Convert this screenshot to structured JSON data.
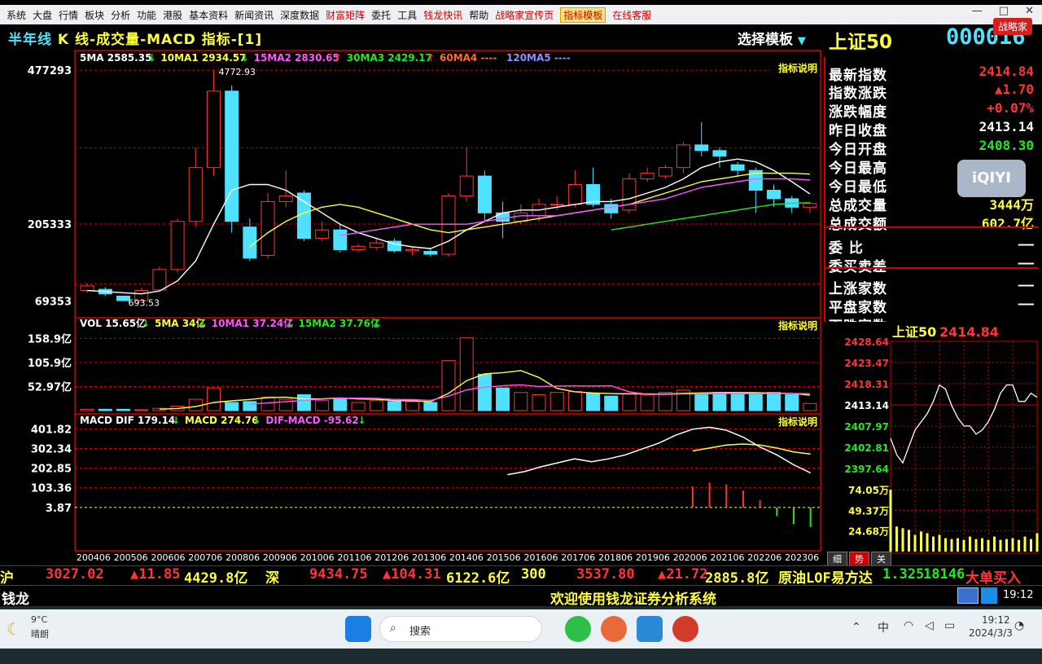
{
  "menu": [
    "系统",
    "大盘",
    "行情",
    "板块",
    "分析",
    "功能",
    "港股",
    "基本资料",
    "新闻资讯",
    "深度数据",
    "财富矩阵",
    "委托",
    "工具",
    "钱龙快讯",
    "帮助",
    "战略家宣传页",
    "指标模板",
    "在线客服"
  ],
  "menu_red": [
    false,
    false,
    false,
    false,
    false,
    false,
    false,
    false,
    false,
    false,
    true,
    false,
    false,
    true,
    false,
    true,
    true,
    true
  ],
  "title": {
    "period": "半年线",
    "chart_title": "K 线-成交量-MACD 指标-[1]",
    "choose_template": "选择模板",
    "name": "上证50",
    "code": "000016",
    "brand": "战略家"
  },
  "kline": {
    "legend": [
      {
        "text": "5MA 2585.35",
        "color": "#ffffff",
        "arrow": "↓",
        "arrow_color": "#22e722"
      },
      {
        "text": "10MA1 2934.57",
        "color": "#ffff3a",
        "arrow": "↓",
        "arrow_color": "#22e722"
      },
      {
        "text": "15MA2 2830.65",
        "color": "#ff55ff",
        "arrow": "↑",
        "arrow_color": "#ff3434"
      },
      {
        "text": "30MA3 2429.17",
        "color": "#22e722",
        "arrow": "↑",
        "arrow_color": "#ff3434"
      },
      {
        "text": "60MA4 ----",
        "color": "#ff6b2b",
        "arrow": "",
        "arrow_color": ""
      },
      {
        "text": "120MA5 ----",
        "color": "#8f8fff",
        "arrow": "",
        "arrow_color": ""
      }
    ],
    "y_labels": [
      "477293",
      "205333",
      "69353"
    ],
    "high_label": "4772.93",
    "low_label": "693.53",
    "indicator_note": "指标说明",
    "candles": [
      {
        "o": 880,
        "c": 960,
        "h": 1010,
        "l": 840
      },
      {
        "o": 900,
        "c": 820,
        "h": 940,
        "l": 780
      },
      {
        "o": 780,
        "c": 700,
        "h": 790,
        "l": 690
      },
      {
        "o": 700,
        "c": 880,
        "h": 930,
        "l": 690
      },
      {
        "o": 890,
        "c": 1250,
        "h": 1300,
        "l": 870
      },
      {
        "o": 1250,
        "c": 2100,
        "h": 2150,
        "l": 1200
      },
      {
        "o": 2100,
        "c": 3050,
        "h": 3400,
        "l": 2000
      },
      {
        "o": 3050,
        "c": 4400,
        "h": 4772,
        "l": 2900
      },
      {
        "o": 4400,
        "c": 2100,
        "h": 4500,
        "l": 1900
      },
      {
        "o": 2000,
        "c": 1450,
        "h": 2150,
        "l": 1400
      },
      {
        "o": 1500,
        "c": 2450,
        "h": 2600,
        "l": 1450
      },
      {
        "o": 2450,
        "c": 2550,
        "h": 3000,
        "l": 2350
      },
      {
        "o": 2600,
        "c": 1800,
        "h": 2650,
        "l": 1750
      },
      {
        "o": 1800,
        "c": 1950,
        "h": 2100,
        "l": 1750
      },
      {
        "o": 1950,
        "c": 1600,
        "h": 2050,
        "l": 1550
      },
      {
        "o": 1600,
        "c": 1660,
        "h": 1700,
        "l": 1550
      },
      {
        "o": 1640,
        "c": 1720,
        "h": 1800,
        "l": 1600
      },
      {
        "o": 1750,
        "c": 1580,
        "h": 1800,
        "l": 1550
      },
      {
        "o": 1580,
        "c": 1600,
        "h": 1650,
        "l": 1500
      },
      {
        "o": 1570,
        "c": 1520,
        "h": 1620,
        "l": 1480
      },
      {
        "o": 1520,
        "c": 2550,
        "h": 2600,
        "l": 1480
      },
      {
        "o": 2550,
        "c": 2900,
        "h": 3400,
        "l": 2450
      },
      {
        "o": 2900,
        "c": 2250,
        "h": 3000,
        "l": 2100
      },
      {
        "o": 2250,
        "c": 2100,
        "h": 2450,
        "l": 1800
      },
      {
        "o": 2100,
        "c": 2250,
        "h": 2400,
        "l": 2050
      },
      {
        "o": 2200,
        "c": 2400,
        "h": 2500,
        "l": 2100
      },
      {
        "o": 2400,
        "c": 2400,
        "h": 2550,
        "l": 2300
      },
      {
        "o": 2400,
        "c": 2750,
        "h": 3000,
        "l": 2350
      },
      {
        "o": 2750,
        "c": 2400,
        "h": 3050,
        "l": 2350
      },
      {
        "o": 2400,
        "c": 2250,
        "h": 2500,
        "l": 2150
      },
      {
        "o": 2300,
        "c": 2850,
        "h": 2950,
        "l": 2250
      },
      {
        "o": 2850,
        "c": 2950,
        "h": 3050,
        "l": 2800
      },
      {
        "o": 2900,
        "c": 3050,
        "h": 3100,
        "l": 2850
      },
      {
        "o": 3050,
        "c": 3450,
        "h": 3500,
        "l": 2950
      },
      {
        "o": 3450,
        "c": 3350,
        "h": 3850,
        "l": 3250
      },
      {
        "o": 3350,
        "c": 3250,
        "h": 3400,
        "l": 3050
      },
      {
        "o": 3100,
        "c": 3000,
        "h": 3150,
        "l": 2900
      },
      {
        "o": 3000,
        "c": 2650,
        "h": 3050,
        "l": 2250
      },
      {
        "o": 2650,
        "c": 2500,
        "h": 2750,
        "l": 2350
      },
      {
        "o": 2500,
        "c": 2350,
        "h": 2550,
        "l": 2250
      },
      {
        "o": 2350,
        "c": 2415,
        "h": 2450,
        "l": 2250
      }
    ],
    "ma5": [
      880,
      860,
      840,
      820,
      870,
      1050,
      1400,
      2050,
      2650,
      2750,
      2750,
      2650,
      2450,
      2250,
      2050,
      1900,
      1800,
      1700,
      1650,
      1620,
      1750,
      1950,
      2100,
      2250,
      2300,
      2300,
      2350,
      2400,
      2450,
      2450,
      2500,
      2600,
      2700,
      2850,
      3050,
      3150,
      3200,
      3150,
      3000,
      2800,
      2585
    ],
    "ma10": [
      null,
      null,
      null,
      null,
      null,
      null,
      null,
      null,
      null,
      1650,
      1900,
      2100,
      2250,
      2350,
      2400,
      2350,
      2250,
      2150,
      2050,
      1950,
      1900,
      1950,
      2000,
      2050,
      2100,
      2150,
      2200,
      2250,
      2300,
      2350,
      2400,
      2500,
      2600,
      2700,
      2800,
      2850,
      2900,
      2950,
      2950,
      2950,
      2935
    ],
    "ma15": [
      null,
      null,
      null,
      null,
      null,
      null,
      null,
      null,
      null,
      null,
      null,
      null,
      null,
      null,
      1850,
      1900,
      1950,
      2000,
      2050,
      2050,
      2050,
      2050,
      2100,
      2150,
      2200,
      2200,
      2200,
      2250,
      2300,
      2350,
      2400,
      2450,
      2500,
      2600,
      2700,
      2750,
      2800,
      2850,
      2850,
      2850,
      2830
    ],
    "ma30": [
      null,
      null,
      null,
      null,
      null,
      null,
      null,
      null,
      null,
      null,
      null,
      null,
      null,
      null,
      null,
      null,
      null,
      null,
      null,
      null,
      null,
      null,
      null,
      null,
      null,
      null,
      null,
      null,
      null,
      1950,
      2000,
      2050,
      2100,
      2150,
      2200,
      2250,
      2300,
      2350,
      2400,
      2420,
      2429
    ]
  },
  "volume": {
    "legend": [
      {
        "text": "VOL 15.65亿",
        "color": "#ffffff",
        "arrow": "↓",
        "arrow_color": "#22e722"
      },
      {
        "text": "5MA 34亿",
        "color": "#ffff3a",
        "arrow": "↓",
        "arrow_color": "#22e722"
      },
      {
        "text": "10MA1 37.24亿",
        "color": "#ff55ff",
        "arrow": "↓",
        "arrow_color": "#22e722"
      },
      {
        "text": "15MA2 37.76亿",
        "color": "#22e722",
        "arrow": "↓",
        "arrow_color": "#22e722"
      }
    ],
    "y_labels": [
      "158.9亿",
      "105.9亿",
      "52.97亿"
    ],
    "indicator_note": "指标说明",
    "bars": [
      3,
      3,
      3,
      2,
      5,
      10,
      25,
      50,
      18,
      20,
      30,
      25,
      35,
      22,
      28,
      18,
      22,
      20,
      20,
      18,
      110,
      160,
      80,
      50,
      40,
      35,
      40,
      42,
      38,
      32,
      38,
      35,
      40,
      45,
      38,
      40,
      36,
      38,
      40,
      35,
      15.65
    ],
    "ma5": [
      null,
      null,
      null,
      null,
      3.2,
      4.6,
      9,
      18,
      21.6,
      24.6,
      28.6,
      29.6,
      25.6,
      26,
      28,
      25.6,
      25,
      22,
      21.6,
      19.6,
      38,
      66,
      81,
      83.6,
      88,
      73,
      49,
      41.4,
      39,
      37.4,
      36.6,
      37,
      36.6,
      38,
      39,
      39.6,
      39.8,
      39.4,
      38.4,
      38,
      34
    ],
    "ma10": [
      null,
      null,
      null,
      null,
      null,
      null,
      null,
      null,
      null,
      14.1,
      16.8,
      19.5,
      22.7,
      25.1,
      27.4,
      27.4,
      27.1,
      24.8,
      24.2,
      22.6,
      31.9,
      45.7,
      51.5,
      54.8,
      56.8,
      53.1,
      54.2,
      54.4,
      54.2,
      54.6,
      41.4,
      35.9,
      35.9,
      36.5,
      36.7,
      37.6,
      37.6,
      37.2,
      37.4,
      37.7,
      37.24
    ]
  },
  "macd": {
    "legend": [
      {
        "text": "MACD DIF 179.14",
        "color": "#ffffff",
        "arrow": "↓",
        "arrow_color": "#22e722"
      },
      {
        "text": "MACD 274.76",
        "color": "#ffff3a",
        "arrow": "↓",
        "arrow_color": "#22e722"
      },
      {
        "text": "DIF-MACD -95.62",
        "color": "#ff55ff",
        "arrow": "↓",
        "arrow_color": "#22e722"
      }
    ],
    "y_labels": [
      "401.82",
      "302.34",
      "202.85",
      "103.36",
      "3.87"
    ],
    "indicator_note": "指标说明",
    "dif": [
      null,
      null,
      null,
      null,
      null,
      null,
      null,
      null,
      null,
      null,
      null,
      null,
      null,
      null,
      null,
      null,
      null,
      null,
      null,
      null,
      null,
      null,
      null,
      null,
      null,
      170,
      185,
      210,
      230,
      250,
      235,
      250,
      270,
      300,
      330,
      370,
      400,
      410,
      395,
      360,
      310,
      270,
      220,
      179.14
    ],
    "dea": [
      null,
      null,
      null,
      null,
      null,
      null,
      null,
      null,
      null,
      null,
      null,
      null,
      null,
      null,
      null,
      null,
      null,
      null,
      null,
      null,
      null,
      null,
      null,
      null,
      null,
      null,
      null,
      null,
      null,
      null,
      null,
      null,
      null,
      null,
      null,
      null,
      290,
      305,
      320,
      325,
      320,
      305,
      285,
      274.76
    ],
    "hist": [
      null,
      null,
      null,
      null,
      null,
      null,
      null,
      null,
      null,
      null,
      null,
      null,
      null,
      null,
      null,
      null,
      null,
      null,
      null,
      null,
      null,
      null,
      null,
      null,
      null,
      null,
      null,
      null,
      null,
      null,
      null,
      null,
      null,
      null,
      null,
      null,
      110,
      130,
      120,
      90,
      40,
      -40,
      -80,
      -95.62
    ]
  },
  "x_labels": [
    "200406",
    "200506",
    "200606",
    "200706",
    "200806",
    "200906",
    "201006",
    "201106",
    "201206",
    "201306",
    "201406",
    "201506",
    "201606",
    "201706",
    "201806",
    "201906",
    "202006",
    "202106",
    "202206",
    "202306"
  ],
  "quote": [
    {
      "label": "最新指数",
      "value": "2414.84",
      "color": "red"
    },
    {
      "label": "指数涨跌",
      "value": "▲1.70",
      "color": "red"
    },
    {
      "label": "涨跌幅度",
      "value": "+0.07%",
      "color": "red"
    },
    {
      "label": "昨日收盘",
      "value": "2413.14",
      "color": "white"
    },
    {
      "label": "今日开盘",
      "value": "2408.30",
      "color": "green"
    },
    {
      "label": "今日最高",
      "value": "",
      "color": "red"
    },
    {
      "label": "今日最低",
      "value": "",
      "color": "green"
    },
    {
      "label": "总成交量",
      "value": "3444万",
      "color": "yellow"
    },
    {
      "label": "总成交额",
      "value": "602.7亿",
      "color": "yellow"
    },
    {
      "label": "委    比",
      "value": "——",
      "color": "white"
    },
    {
      "label": "委买卖差",
      "value": "——",
      "color": "white"
    },
    {
      "label": "上涨家数",
      "value": "——",
      "color": "white"
    },
    {
      "label": "平盘家数",
      "value": "——",
      "color": "white"
    },
    {
      "label": "下跌家数",
      "value": "——",
      "color": "white"
    }
  ],
  "watermark": "iQIYI",
  "mini": {
    "title": "上证50",
    "last": "2414.84",
    "y_labels": [
      "2428.64",
      "2423.47",
      "2418.31",
      "2413.14",
      "2407.97",
      "2402.81",
      "2397.64"
    ],
    "vol_labels": [
      "74.05万",
      "49.37万",
      "24.68万"
    ],
    "tabs": [
      "细",
      "势",
      "关"
    ],
    "price": [
      2405,
      2401,
      2399,
      2403,
      2407,
      2409,
      2411,
      2414,
      2418,
      2417,
      2413,
      2410,
      2408,
      2408,
      2406,
      2407,
      2409,
      2412,
      2416,
      2418,
      2418,
      2414,
      2414,
      2416,
      2415
    ],
    "vol": [
      74,
      30,
      28,
      26,
      20,
      24,
      22,
      18,
      20,
      16,
      15,
      16,
      14,
      18,
      15,
      16,
      14,
      18,
      14,
      15,
      16,
      14,
      18,
      15,
      22
    ]
  },
  "status": [
    {
      "text": "沪",
      "color": "yellow"
    },
    {
      "text": "3027.02",
      "color": "red"
    },
    {
      "text": "▲11.85",
      "color": "red"
    },
    {
      "text": "4429.8亿",
      "color": "yellow"
    },
    {
      "text": "深",
      "color": "yellow"
    },
    {
      "text": "9434.75",
      "color": "red"
    },
    {
      "text": "▲104.31",
      "color": "red"
    },
    {
      "text": "6122.6亿",
      "color": "yellow"
    },
    {
      "text": "300",
      "color": "yellow"
    },
    {
      "text": "3537.80",
      "color": "red"
    },
    {
      "text": "▲21.72",
      "color": "red"
    },
    {
      "text": "2885.8亿",
      "color": "yellow"
    },
    {
      "text": "原油LOF易方达",
      "color": "yellow"
    },
    {
      "text": "1.325",
      "color": "green"
    },
    {
      "text": "18146",
      "color": "green"
    },
    {
      "text": "大单买入",
      "color": "red"
    }
  ],
  "status2": {
    "left": "钱龙",
    "welcome": "欢迎使用钱龙证券分析系统",
    "time": "19:12"
  },
  "taskbar": {
    "weather_temp": "9°C",
    "weather_desc": "晴朗",
    "search": "搜索",
    "time": "19:12",
    "date": "2024/3/3",
    "ime": "中"
  }
}
